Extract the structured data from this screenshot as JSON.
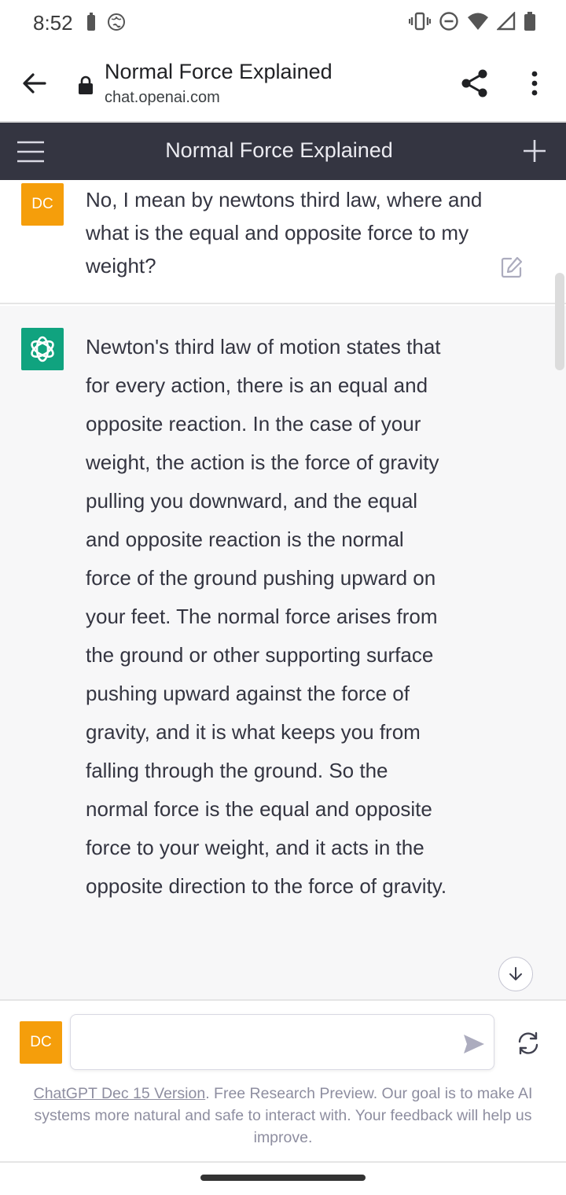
{
  "status_bar": {
    "time": "8:52",
    "left_icons": [
      "battery-saver-icon",
      "globe-icon"
    ],
    "right_icons": [
      "vibrate-icon",
      "do-not-disturb-icon",
      "wifi-icon",
      "cellular-icon",
      "battery-icon"
    ]
  },
  "browser": {
    "page_title": "Normal Force Explained",
    "host": "chat.openai.com",
    "icons": [
      "back-arrow-icon",
      "lock-icon",
      "share-icon",
      "more-vert-icon"
    ]
  },
  "app_header": {
    "title": "Normal Force Explained",
    "icons": [
      "hamburger-menu-icon",
      "plus-icon"
    ]
  },
  "conversation": {
    "user_message": {
      "avatar_initials": "DC",
      "text": "No, I mean by newtons third law, where and what is the equal and opposite force to my weight?"
    },
    "assistant_message": {
      "text": "Newton's third law of motion states that for every action, there is an equal and opposite reaction. In the case of your weight, the action is the force of gravity pulling you downward, and the equal and opposite reaction is the normal force of the ground pushing upward on your feet. The normal force arises from the ground or other supporting surface pushing upward against the force of gravity, and it is what keeps you from falling through the ground. So the normal force is the equal and opposite force to your weight, and it acts in the opposite direction to the force of gravity."
    }
  },
  "composer": {
    "avatar_initials": "DC",
    "input_value": "",
    "input_placeholder": ""
  },
  "footer": {
    "link_text": "ChatGPT Dec 15 Version",
    "note": ". Free Research Preview. Our goal is to make AI systems more natural and safe to interact with. Your feedback will help us improve."
  },
  "colors": {
    "app_header_bg": "#343541",
    "user_avatar": "#f59e0b",
    "assistant_avatar": "#10a37f",
    "assistant_bg": "#f7f7f8"
  }
}
